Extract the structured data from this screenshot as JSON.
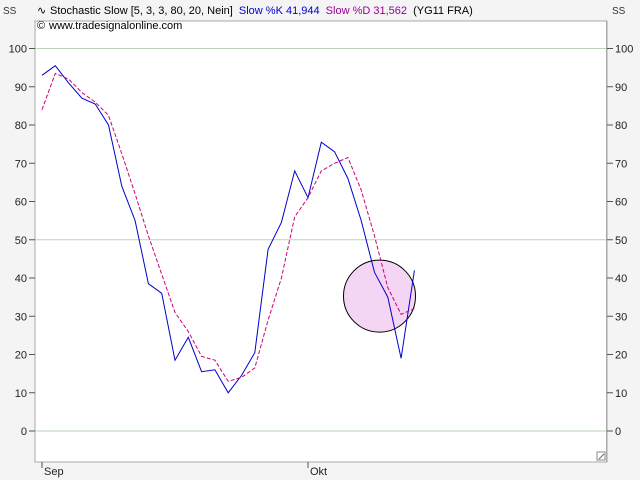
{
  "header": {
    "indicator_icon": "stochastic-wave-icon",
    "indicator_label": "Stochastic Slow [5, 3, 3, 80, 20, Nein]",
    "k_label": "Slow %K 41,944",
    "d_label": "Slow %D 31,562",
    "symbol": "(YG11 FRA)",
    "copyright_icon": "copyright-icon",
    "source": "www.tradesignalonline.com",
    "corner_left": "SS",
    "corner_right": "SS"
  },
  "colors": {
    "k_line": "#0000cc",
    "d_line": "#cc0077",
    "grid": "#b9d4b9",
    "highlight_fill": "#f0c8f0",
    "highlight_stroke": "#000000"
  },
  "chart_data": {
    "type": "line",
    "title": "Stochastic Slow [5, 3, 3, 80, 20, Nein]",
    "ylim": [
      -8,
      108
    ],
    "yticks": [
      0,
      10,
      20,
      30,
      40,
      50,
      60,
      70,
      80,
      90,
      100
    ],
    "grid": true,
    "grid_lines": [
      0,
      50,
      100
    ],
    "x_labels": [
      {
        "label": "Sep",
        "index": 0
      },
      {
        "label": "Okt",
        "index": 20
      }
    ],
    "highlight": {
      "shape": "circle",
      "center_index": 25,
      "center_value": 35
    },
    "series": [
      {
        "name": "Slow %K",
        "style": "solid",
        "values": [
          93,
          95.5,
          91,
          87,
          85.5,
          80,
          64,
          55,
          38.5,
          36,
          18.5,
          24.5,
          15.5,
          16,
          10,
          14.5,
          20.5,
          47.5,
          54.5,
          68,
          61,
          75.5,
          73,
          66,
          55,
          41.5,
          35,
          19,
          42
        ]
      },
      {
        "name": "Slow %D",
        "style": "dashed",
        "values": [
          84,
          93.5,
          92,
          88.5,
          86,
          82.5,
          72.5,
          62,
          51,
          41,
          31,
          26,
          19.5,
          18.5,
          13,
          14,
          16.5,
          29,
          40,
          56,
          61,
          68,
          70,
          71.5,
          63,
          51,
          37.5,
          30.5,
          32
        ]
      }
    ]
  }
}
